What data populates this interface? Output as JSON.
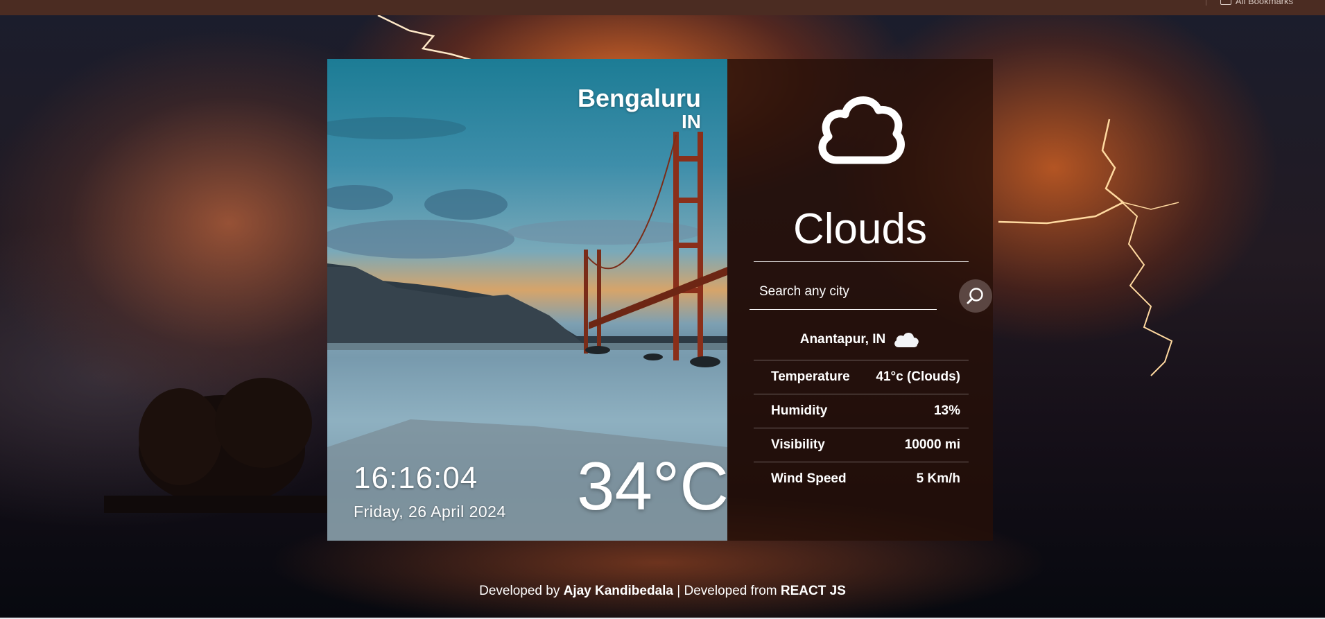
{
  "browser": {
    "bookmarks_label": "All Bookmarks"
  },
  "weather": {
    "city": "Bengaluru",
    "country": "IN",
    "time": "16:16:04",
    "date": "Friday, 26 April 2024",
    "temperature": "34°C",
    "condition": "Clouds",
    "condition_icon": "cloud-icon"
  },
  "search": {
    "placeholder": "Search any city",
    "value": ""
  },
  "result": {
    "location": "Anantapur, IN",
    "icon": "cloud-icon",
    "rows": [
      {
        "label": "Temperature",
        "value": "41°c (Clouds)"
      },
      {
        "label": "Humidity",
        "value": "13%"
      },
      {
        "label": "Visibility",
        "value": "10000 mi"
      },
      {
        "label": "Wind Speed",
        "value": "5 Km/h"
      }
    ]
  },
  "footer": {
    "prefix": "Developed by",
    "author": "Ajay Kandibedala",
    "middle": "| Developed from",
    "framework": "REACT JS"
  }
}
